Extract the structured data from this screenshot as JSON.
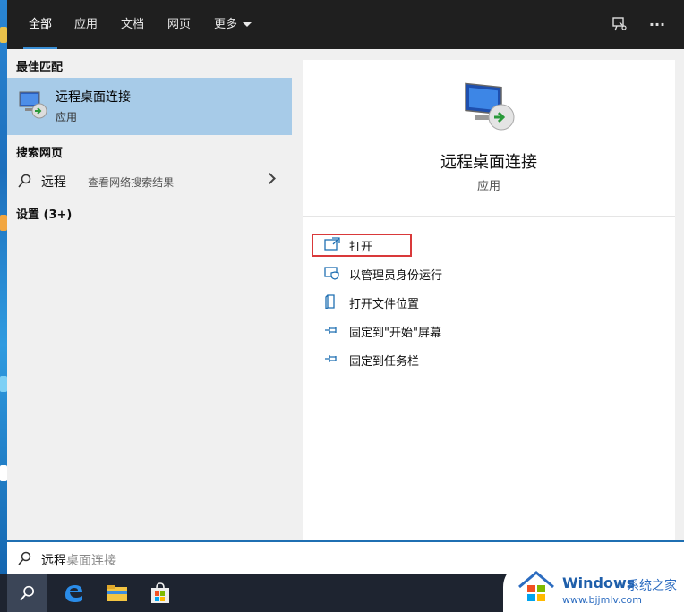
{
  "tabs": [
    "全部",
    "应用",
    "文档",
    "网页",
    "更多"
  ],
  "left": {
    "best_match_header": "最佳匹配",
    "best_match": {
      "title": "远程桌面连接",
      "subtitle": "应用"
    },
    "web_header": "搜索网页",
    "web_result": {
      "query": "远程",
      "hint": "- 查看网络搜索结果"
    },
    "settings_header": "设置 (3+)"
  },
  "detail": {
    "title": "远程桌面连接",
    "subtitle": "应用",
    "actions": [
      "打开",
      "以管理员身份运行",
      "打开文件位置",
      "固定到\"开始\"屏幕",
      "固定到任务栏"
    ]
  },
  "search": {
    "typed": "远程",
    "suggestion": "桌面连接"
  },
  "watermark": {
    "brand": "Windows",
    "site_cn": "系统之家",
    "url": "www.bjjmlv.com"
  },
  "icons": {
    "feedback": "feedback-icon",
    "more": "more-dots-icon",
    "search": "search-icon",
    "edge": "edge-icon",
    "explorer": "file-explorer-icon",
    "store": "store-icon"
  },
  "colors": {
    "accent": "#3a8fd6",
    "selected": "#a7cbe8",
    "highlight_box": "#d9393a"
  }
}
